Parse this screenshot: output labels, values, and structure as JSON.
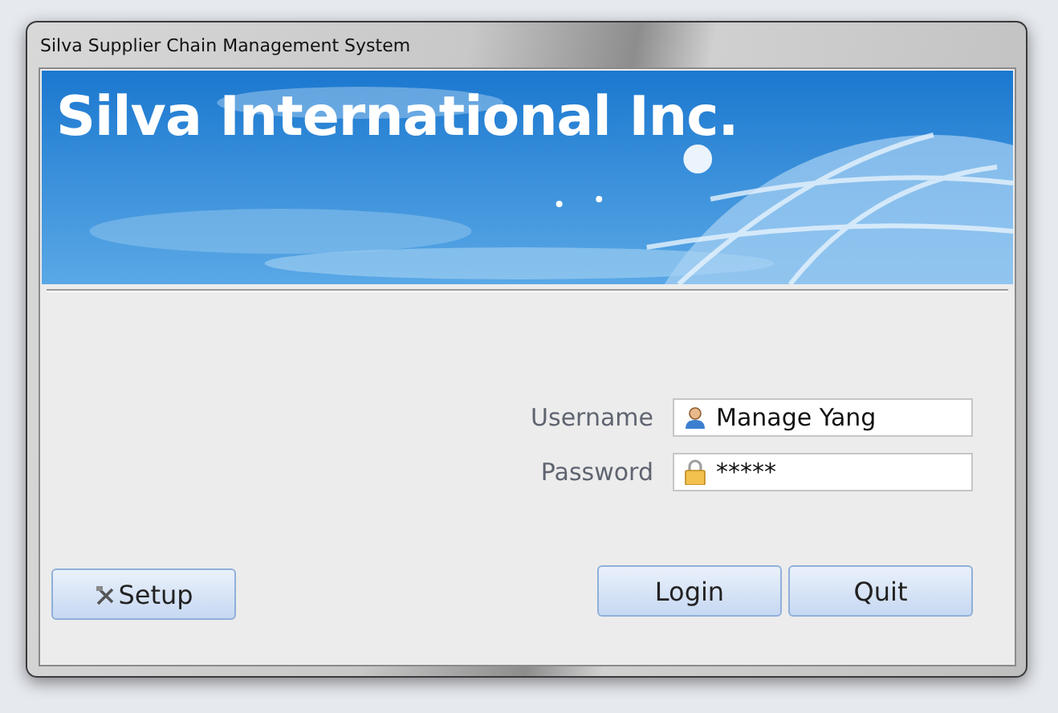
{
  "window": {
    "title": "Silva Supplier Chain Management System"
  },
  "banner": {
    "title": "Silva International Inc.",
    "kind": "picture"
  },
  "fields": [
    {
      "label": "Username",
      "value": "Manage Yang",
      "kind": "user"
    },
    {
      "label": "Password",
      "value": "*****",
      "kind": "lock"
    }
  ],
  "setup_button": {
    "label": "Setup"
  },
  "buttons": [
    "Login",
    "Quit"
  ]
}
